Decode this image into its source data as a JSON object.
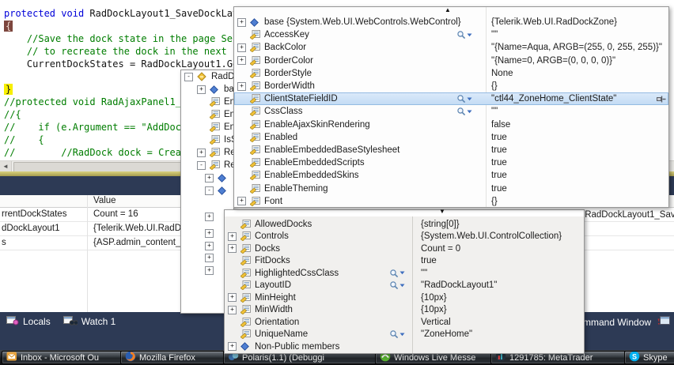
{
  "editor": {
    "lines": [
      [
        [
          "protected",
          "k"
        ],
        [
          " ",
          "p"
        ],
        [
          "void",
          "k"
        ],
        [
          " RadDockLayout1_SaveDockLayout",
          "p"
        ]
      ],
      [
        [
          "{",
          "bR"
        ]
      ],
      [
        [
          "    ",
          "p"
        ],
        [
          "//Save the dock state in the page Sess",
          "c"
        ]
      ],
      [
        [
          "    ",
          "p"
        ],
        [
          "// to recreate the dock in the next Pa",
          "c"
        ]
      ],
      [
        [
          "    CurrentDockStates = RadDockLayout1.Get",
          "p"
        ]
      ],
      [],
      [
        [
          "}",
          "bY"
        ]
      ],
      [
        [
          "//protected void RadAjaxPanel1_Aja",
          "c"
        ]
      ],
      [
        [
          "//{",
          "c"
        ]
      ],
      [
        [
          "//    if (e.Argument == \"AddDock\")",
          "c"
        ]
      ],
      [
        [
          "//    {",
          "c"
        ]
      ],
      [
        [
          "//        //RadDock dock = CreateR",
          "c"
        ]
      ]
    ]
  },
  "datatip_parent": {
    "rows": [
      {
        "expand": "-",
        "icon": "diamond-yellow",
        "label": "RadDo",
        "indent": 0
      },
      {
        "expand": "+",
        "icon": "diamond",
        "label": "ba",
        "indent": 1
      },
      {
        "icon": "prop",
        "label": "En",
        "indent": 1
      },
      {
        "icon": "prop",
        "label": "En",
        "indent": 1
      },
      {
        "icon": "prop",
        "label": "En",
        "indent": 1
      },
      {
        "icon": "prop",
        "label": "IsS",
        "indent": 1
      },
      {
        "expand": "+",
        "icon": "prop",
        "label": "Re",
        "indent": 1
      },
      {
        "expand": "-",
        "icon": "prop",
        "label": "Re",
        "indent": 1
      },
      {
        "expand": "+",
        "icon": "diamond",
        "label": "",
        "indent": 2
      },
      {
        "expand": "-",
        "icon": "diamond",
        "label": "",
        "indent": 2
      }
    ],
    "extra_expanders": [
      "+",
      "+",
      "+",
      "+",
      "+"
    ]
  },
  "properties_popup": {
    "scroll_up": "▲",
    "rows": [
      {
        "expand": "+",
        "icon": "diamond",
        "label": "base {System.Web.UI.WebControls.WebControl}",
        "value": "{Telerik.Web.UI.RadDockZone}"
      },
      {
        "icon": "prop",
        "label": "AccessKey",
        "mag": true,
        "value": "\"\""
      },
      {
        "expand": "+",
        "icon": "prop",
        "label": "BackColor",
        "value": "\"{Name=Aqua, ARGB=(255, 0, 255, 255)}\""
      },
      {
        "expand": "+",
        "icon": "prop",
        "label": "BorderColor",
        "value": "\"{Name=0, ARGB=(0, 0, 0, 0)}\""
      },
      {
        "icon": "prop",
        "label": "BorderStyle",
        "value": "None"
      },
      {
        "expand": "+",
        "icon": "prop",
        "label": "BorderWidth",
        "value": "{}"
      },
      {
        "icon": "prop",
        "label": "ClientStateFieldID",
        "mag": true,
        "value": "\"ctl44_ZoneHome_ClientState\"",
        "selected": true,
        "pin": true
      },
      {
        "icon": "prop",
        "label": "CssClass",
        "mag": true,
        "value": "\"\""
      },
      {
        "icon": "prop",
        "label": "EnableAjaxSkinRendering",
        "value": "false"
      },
      {
        "icon": "prop",
        "label": "Enabled",
        "value": "true"
      },
      {
        "icon": "prop",
        "label": "EnableEmbeddedBaseStylesheet",
        "value": "true"
      },
      {
        "icon": "prop",
        "label": "EnableEmbeddedScripts",
        "value": "true"
      },
      {
        "icon": "prop",
        "label": "EnableEmbeddedSkins",
        "value": "true"
      },
      {
        "icon": "prop",
        "label": "EnableTheming",
        "value": "true"
      },
      {
        "expand": "+",
        "icon": "prop",
        "label": "Font",
        "value": "{}"
      }
    ]
  },
  "properties_popup_lower": {
    "scroll_down": "▼",
    "rows": [
      {
        "icon": "prop",
        "label": "AllowedDocks",
        "value": "{string[0]}"
      },
      {
        "expand": "+",
        "icon": "prop",
        "label": "Controls",
        "value": "{System.Web.UI.ControlCollection}"
      },
      {
        "expand": "+",
        "icon": "prop",
        "label": "Docks",
        "value": "Count = 0"
      },
      {
        "icon": "prop",
        "label": "FitDocks",
        "value": "true"
      },
      {
        "icon": "prop",
        "label": "HighlightedCssClass",
        "mag": true,
        "value": "\"\""
      },
      {
        "icon": "prop",
        "label": "LayoutID",
        "mag": true,
        "value": "\"RadDockLayout1\""
      },
      {
        "expand": "+",
        "icon": "prop",
        "label": "MinHeight",
        "value": "{10px}"
      },
      {
        "expand": "+",
        "icon": "prop",
        "label": "MinWidth",
        "value": "{10px}"
      },
      {
        "icon": "prop",
        "label": "Orientation",
        "value": "Vertical"
      },
      {
        "icon": "prop",
        "label": "UniqueName",
        "mag": true,
        "value": "\"ZoneHome\""
      },
      {
        "expand": "+",
        "icon": "diamond",
        "label": "Non-Public members",
        "value": ""
      }
    ]
  },
  "watch_window": {
    "value_column_header": "Value",
    "rows": [
      {
        "name": "rrentDockStates",
        "value": "Count = 16"
      },
      {
        "name": "dDockLayout1",
        "value": "{Telerik.Web.UI.RadDockLa"
      },
      {
        "name": "s",
        "value": "{ASP.admin_content_pulsa"
      }
    ],
    "right_fragment": ".RadDockLayout1_Sav"
  },
  "debug_tabs": {
    "tabs": [
      {
        "label": "Locals",
        "icon": "locals"
      },
      {
        "label": "Watch 1",
        "icon": "watch"
      }
    ],
    "right_label": "mmand Window"
  },
  "taskbar": {
    "buttons": [
      {
        "label": "Inbox - Microsoft Ou",
        "icon": "outlook"
      },
      {
        "label": "Mozilla Firefox",
        "icon": "firefox"
      },
      {
        "label": "Polaris(1.1) (Debuggi",
        "icon": "polaris"
      },
      {
        "label": "Windows Live Messe",
        "icon": "messenger"
      },
      {
        "label": "1291785: MetaTrader",
        "icon": "metatrader"
      },
      {
        "label": "Skype",
        "icon": "skype"
      }
    ]
  },
  "colors": {
    "navy": "#2d3a55",
    "selection_blue": "#c2dbf4",
    "keyword_blue": "#0000d8",
    "comment_green": "#007d00",
    "brace_highlight_red": "#7d463e",
    "current_line_yellow": "#f7ef00",
    "popup_gray": "#f1f0ee"
  }
}
